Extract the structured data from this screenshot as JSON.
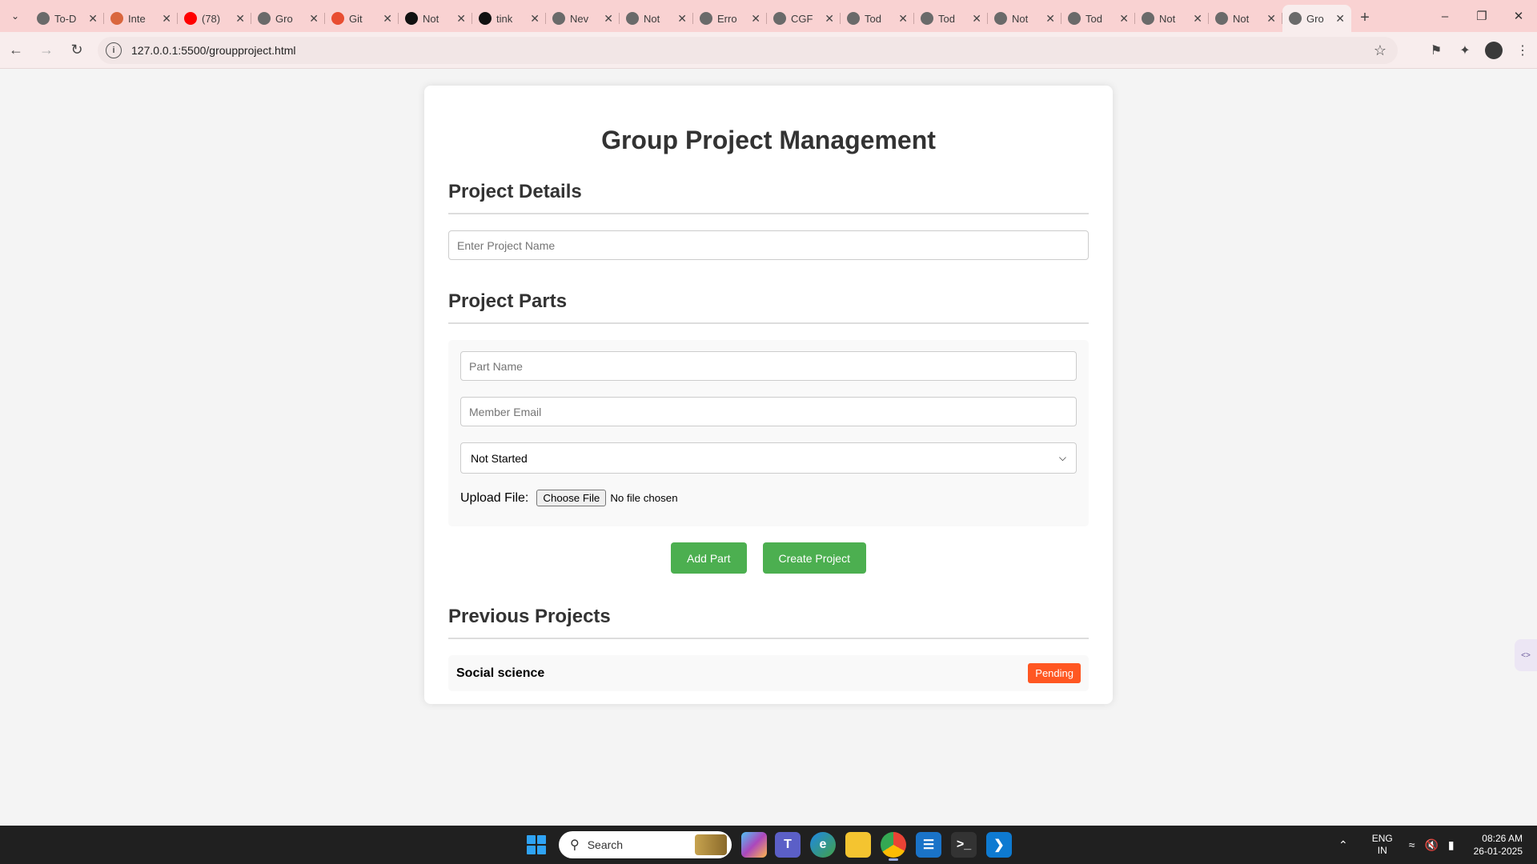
{
  "browser": {
    "tabs": [
      {
        "title": "To-D",
        "favicon": "globe-icon",
        "color": "#6a6a6a"
      },
      {
        "title": "Inte",
        "favicon": "spark-icon",
        "color": "#d9663d"
      },
      {
        "title": "(78)",
        "favicon": "youtube-icon",
        "color": "#ff0000"
      },
      {
        "title": "Gro",
        "favicon": "globe-icon",
        "color": "#6a6a6a"
      },
      {
        "title": "Git",
        "favicon": "git-icon",
        "color": "#e84d31"
      },
      {
        "title": "Not",
        "favicon": "github-icon",
        "color": "#111111"
      },
      {
        "title": "tink",
        "favicon": "github-icon",
        "color": "#111111"
      },
      {
        "title": "Nev",
        "favicon": "globe-icon",
        "color": "#6a6a6a"
      },
      {
        "title": "Not",
        "favicon": "globe-icon",
        "color": "#6a6a6a"
      },
      {
        "title": "Erro",
        "favicon": "globe-icon",
        "color": "#6a6a6a"
      },
      {
        "title": "CGF",
        "favicon": "globe-icon",
        "color": "#6a6a6a"
      },
      {
        "title": "Tod",
        "favicon": "globe-icon",
        "color": "#6a6a6a"
      },
      {
        "title": "Tod",
        "favicon": "globe-icon",
        "color": "#6a6a6a"
      },
      {
        "title": "Not",
        "favicon": "globe-icon",
        "color": "#6a6a6a"
      },
      {
        "title": "Tod",
        "favicon": "globe-icon",
        "color": "#6a6a6a"
      },
      {
        "title": "Not",
        "favicon": "globe-icon",
        "color": "#6a6a6a"
      },
      {
        "title": "Not",
        "favicon": "globe-icon",
        "color": "#6a6a6a"
      },
      {
        "title": "Gro",
        "favicon": "globe-icon",
        "color": "#6a6a6a",
        "active": true
      }
    ],
    "url": "127.0.0.1:5500/groupproject.html"
  },
  "page": {
    "title": "Group Project Management",
    "project_details": {
      "heading": "Project Details",
      "project_name_placeholder": "Enter Project Name"
    },
    "project_parts": {
      "heading": "Project Parts",
      "part_name_placeholder": "Part Name",
      "member_email_placeholder": "Member Email",
      "status_selected": "Not Started",
      "upload_label": "Upload File:",
      "choose_file_label": "Choose File",
      "no_file_text": "No file chosen"
    },
    "buttons": {
      "add_part": "Add Part",
      "create_project": "Create Project"
    },
    "previous_projects": {
      "heading": "Previous Projects",
      "items": [
        {
          "name": "Social science",
          "status": "Pending",
          "status_color": "#ff5722"
        }
      ]
    }
  },
  "taskbar": {
    "search_label": "Search",
    "language": "ENG",
    "region": "IN",
    "time": "08:26 AM",
    "date": "26-01-2025"
  },
  "colors": {
    "accent_button": "#4caf50",
    "pending_badge": "#ff5722",
    "tab_strip": "#f9d2d2"
  }
}
